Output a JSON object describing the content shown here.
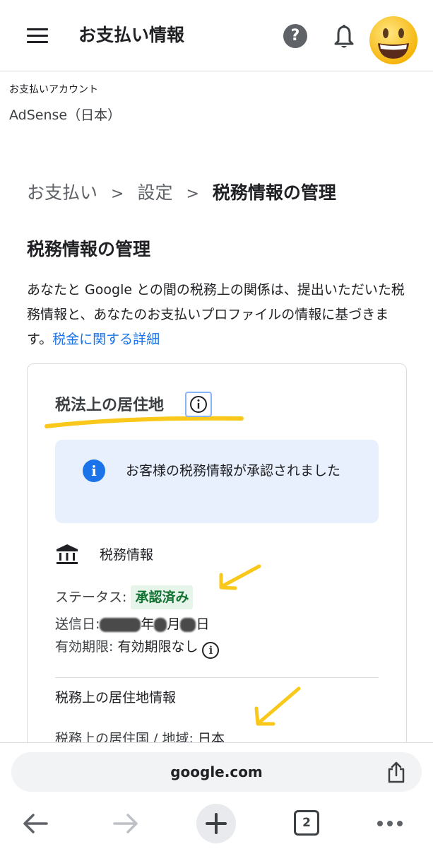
{
  "header": {
    "title": "お支払い情報",
    "help_icon": "help-icon",
    "bell_icon": "notification-bell-icon",
    "avatar_icon": "smiley-emoji"
  },
  "account": {
    "label": "お支払いアカウント",
    "name": "AdSense（日本）"
  },
  "breadcrumb": {
    "items": [
      "お支払い",
      "設定",
      "税務情報の管理"
    ],
    "separator": ">"
  },
  "page": {
    "title": "税務情報の管理",
    "description": "あなたと Google との間の税務上の関係は、提出いただいた税務情報と、あなたのお支払いプロファイルの情報に基づきます。",
    "link": "税金に関する詳細"
  },
  "card": {
    "section_title": "税法上の居住地",
    "notice": "お客様の税務情報が承認されました",
    "tax_info_title": "税務情報",
    "status_label": "ステータス:",
    "status_value": "承認済み",
    "date_label": "送信日:",
    "date_year_unit": "年",
    "date_month_unit": "月",
    "date_day_unit": "日",
    "expiry_label": "有効期限:",
    "expiry_value": "有効期限なし",
    "residence_title": "税務上の居住地情報",
    "country_label": "税務上の居住国 / 地域:",
    "country_value": "日本"
  },
  "browser": {
    "url": "google.com",
    "tab_count": "2"
  },
  "colors": {
    "link": "#1a73e8",
    "status_green": "#137333",
    "notice_bg": "#e8f0fe",
    "highlight": "#f9c81a"
  }
}
